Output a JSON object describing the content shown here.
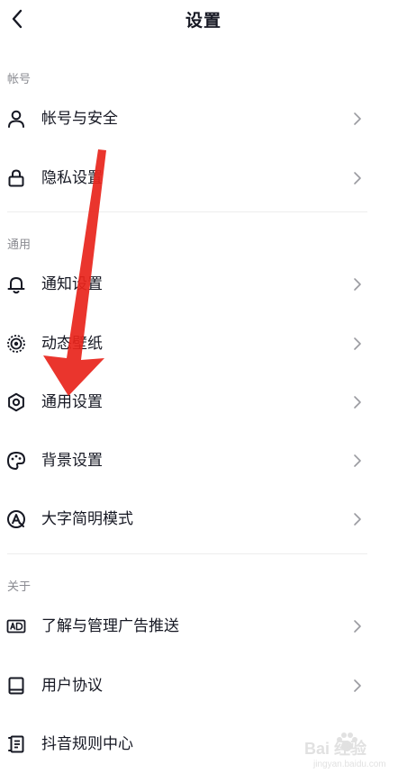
{
  "header": {
    "title": "设置",
    "back_icon": "chevron-left-icon"
  },
  "sections": [
    {
      "title": "帐号",
      "items": [
        {
          "label": "帐号与安全",
          "icon": "user-icon",
          "has_chevron": true
        },
        {
          "label": "隐私设置",
          "icon": "lock-icon",
          "has_chevron": true
        }
      ]
    },
    {
      "title": "通用",
      "items": [
        {
          "label": "通知设置",
          "icon": "bell-icon",
          "has_chevron": true
        },
        {
          "label": "动态壁纸",
          "icon": "live-wallpaper-icon",
          "has_chevron": true
        },
        {
          "label": "通用设置",
          "icon": "gear-icon",
          "has_chevron": true
        },
        {
          "label": "背景设置",
          "icon": "palette-icon",
          "has_chevron": true
        },
        {
          "label": "大字简明模式",
          "icon": "large-text-icon",
          "has_chevron": true
        }
      ]
    },
    {
      "title": "关于",
      "items": [
        {
          "label": "了解与管理广告推送",
          "icon": "ad-icon",
          "has_chevron": true
        },
        {
          "label": "用户协议",
          "icon": "book-icon",
          "has_chevron": true
        },
        {
          "label": "抖音规则中心",
          "icon": "rules-icon",
          "has_chevron": false
        }
      ]
    }
  ],
  "annotation": {
    "icon": "red-arrow-annotation",
    "color": "#e8261d",
    "points_to": "通用设置"
  },
  "watermark": {
    "main_text": "Bai 经验",
    "sub_text": "jingyan.baidu.com"
  }
}
